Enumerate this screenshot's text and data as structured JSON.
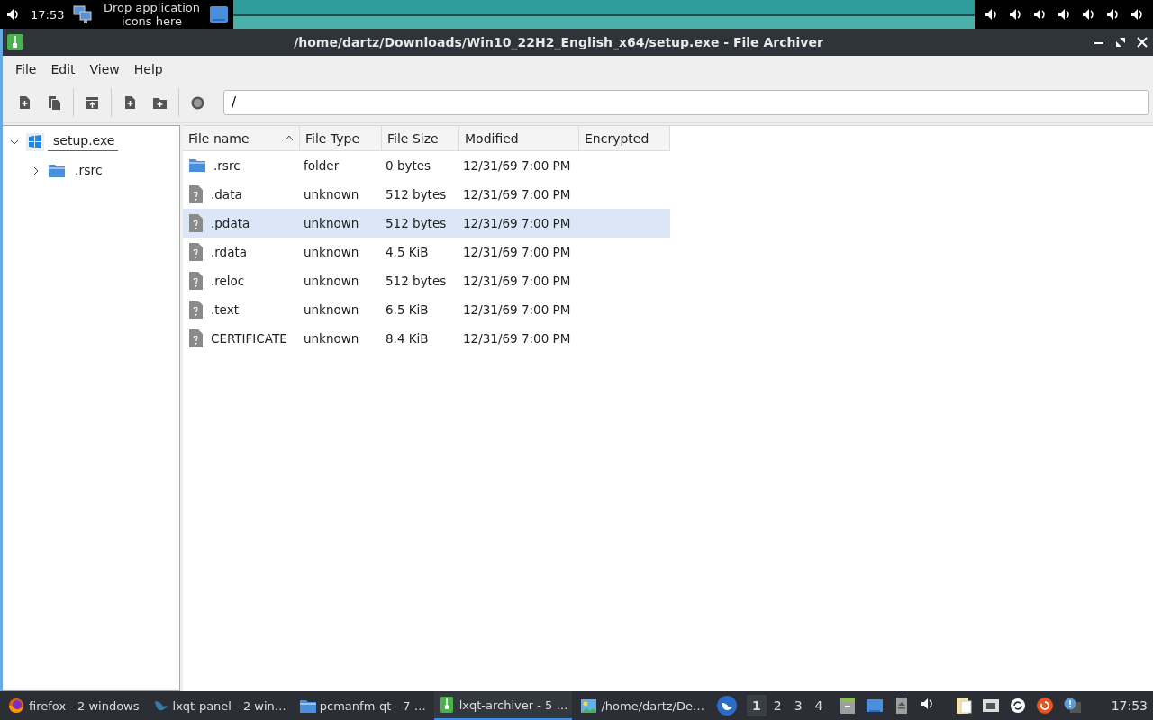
{
  "top_panel": {
    "clock": "17:53",
    "quicklaunch_hint": "Drop application icons here"
  },
  "window": {
    "title": "/home/dartz/Downloads/Win10_22H2_English_x64/setup.exe - File Archiver"
  },
  "menu": [
    "File",
    "Edit",
    "View",
    "Help"
  ],
  "location": {
    "value": "/"
  },
  "tree": [
    {
      "label": "setup.exe",
      "kind": "archive",
      "expanded": true,
      "children": [
        {
          "label": ".rsrc",
          "kind": "folder",
          "expanded": false
        }
      ]
    }
  ],
  "table": {
    "columns": [
      {
        "label": "File name",
        "sorted_ascending": true
      },
      {
        "label": "File Type"
      },
      {
        "label": "File Size"
      },
      {
        "label": "Modified"
      },
      {
        "label": "Encrypted"
      }
    ],
    "rows": [
      {
        "kind": "folder",
        "name": ".rsrc",
        "type": "folder",
        "size": "0 bytes",
        "modified": "12/31/69 7:00 PM",
        "selected": false
      },
      {
        "kind": "file",
        "name": ".data",
        "type": "unknown",
        "size": "512 bytes",
        "modified": "12/31/69 7:00 PM",
        "selected": false
      },
      {
        "kind": "file",
        "name": ".pdata",
        "type": "unknown",
        "size": "512 bytes",
        "modified": "12/31/69 7:00 PM",
        "selected": true
      },
      {
        "kind": "file",
        "name": ".rdata",
        "type": "unknown",
        "size": "4.5 KiB",
        "modified": "12/31/69 7:00 PM",
        "selected": false
      },
      {
        "kind": "file",
        "name": ".reloc",
        "type": "unknown",
        "size": "512 bytes",
        "modified": "12/31/69 7:00 PM",
        "selected": false
      },
      {
        "kind": "file",
        "name": ".text",
        "type": "unknown",
        "size": "6.5 KiB",
        "modified": "12/31/69 7:00 PM",
        "selected": false
      },
      {
        "kind": "file",
        "name": "CERTIFICATE",
        "type": "unknown",
        "size": "8.4 KiB",
        "modified": "12/31/69 7:00 PM",
        "selected": false
      }
    ]
  },
  "taskbar": {
    "tasks": [
      {
        "kind": "browser",
        "label": "firefox - 2 windows",
        "selected": false
      },
      {
        "kind": "panel",
        "label": "lxqt-panel - 2 win…",
        "selected": false
      },
      {
        "kind": "folder",
        "label": "pcmanfm-qt - 7 …",
        "selected": false
      },
      {
        "kind": "archiver",
        "label": "lxqt-archiver - 5 …",
        "selected": true
      },
      {
        "kind": "image",
        "label": "/home/dartz/De…",
        "selected": false
      }
    ],
    "desktops": [
      {
        "label": "1",
        "selected": true
      },
      {
        "label": "2",
        "selected": false
      },
      {
        "label": "3",
        "selected": false
      },
      {
        "label": "4",
        "selected": false
      }
    ],
    "clock": "17:53"
  }
}
